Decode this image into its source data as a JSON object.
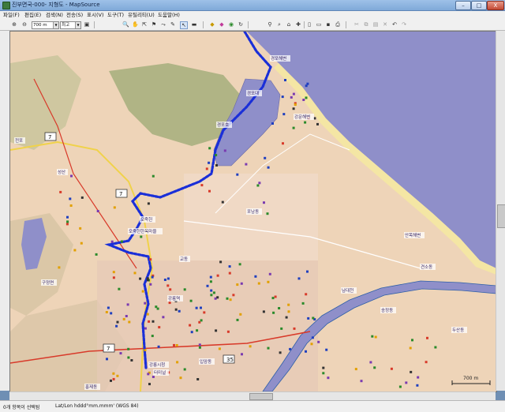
{
  "window": {
    "title": "진부면국-000- 지형도 - MapSource",
    "min_label": "–",
    "max_label": "□",
    "close_label": "X"
  },
  "menu": [
    {
      "label": "파일(F)"
    },
    {
      "label": "편집(E)"
    },
    {
      "label": "검색(N)"
    },
    {
      "label": "전송(S)"
    },
    {
      "label": "표시(V)"
    },
    {
      "label": "도구(T)"
    },
    {
      "label": "유틸리티(U)"
    },
    {
      "label": "도움말(H)"
    }
  ],
  "toolbar": {
    "zoom_scale": "700 m",
    "detail": "최고",
    "zoom_in_icon": "magnifier-plus-icon",
    "zoom_out_icon": "magnifier-minus-icon"
  },
  "map": {
    "colors": {
      "land": "#eed4b8",
      "sea": "#8f8fc9",
      "lake": "#8f8fc9",
      "forest": "#a8b080",
      "route": "#1a2fd8",
      "road_red": "#d83a2a",
      "road_yellow": "#f0d24a",
      "river": "#2e5fa8"
    },
    "labels": [
      {
        "text": "경포해변"
      },
      {
        "text": "경포호"
      },
      {
        "text": "경포대"
      },
      {
        "text": "오죽헌"
      },
      {
        "text": "오죽헌한옥마을"
      },
      {
        "text": "강릉역"
      },
      {
        "text": "교동"
      },
      {
        "text": "포남동"
      },
      {
        "text": "강문해변"
      },
      {
        "text": "남대천"
      },
      {
        "text": "송정동"
      },
      {
        "text": "견소동"
      },
      {
        "text": "안목해변"
      },
      {
        "text": "전포"
      },
      {
        "text": "성산"
      },
      {
        "text": "구정면"
      },
      {
        "text": "홍제동"
      },
      {
        "text": "입암동"
      },
      {
        "text": "두산동"
      },
      {
        "text": "강릉시청"
      },
      {
        "text": "터미널"
      }
    ],
    "route_badges": [
      {
        "text": "7"
      },
      {
        "text": "7"
      },
      {
        "text": "7"
      },
      {
        "text": "35"
      }
    ],
    "scale_bar": "700 m"
  },
  "status": {
    "selection": "0개 항목이 선택됨",
    "coord_format": "Lat/Lon hddd°mm.mmm' (WGS 84)"
  }
}
